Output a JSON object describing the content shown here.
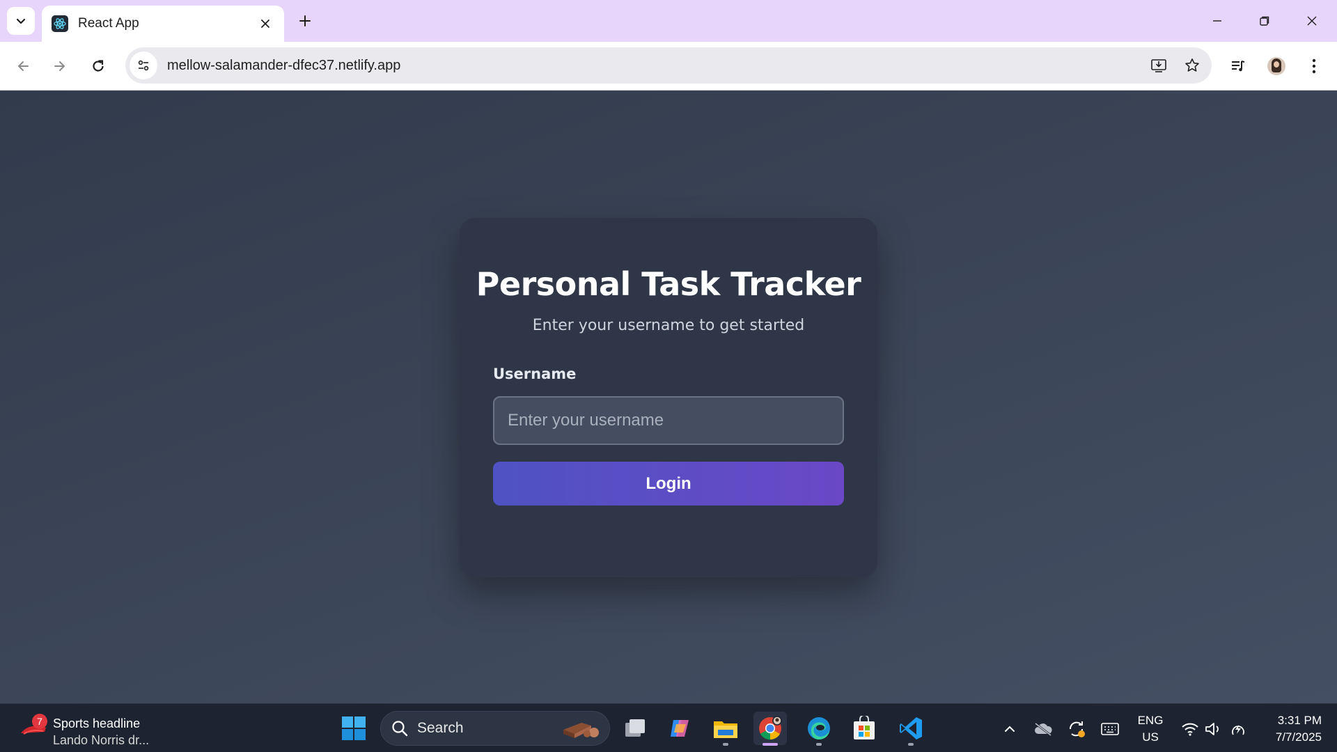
{
  "browser": {
    "tab": {
      "title": "React App"
    },
    "address_bar": {
      "url": "mellow-salamander-dfec37.netlify.app"
    }
  },
  "app": {
    "title": "Personal Task Tracker",
    "subtitle": "Enter your username to get started",
    "username_label": "Username",
    "username_placeholder": "Enter your username",
    "username_value": "",
    "login_label": "Login",
    "colors": {
      "card": "#2e3647",
      "button_start": "#4f52c4",
      "button_end": "#6a48c6"
    }
  },
  "taskbar": {
    "news": {
      "badge": "7",
      "title": "Sports headline",
      "subtitle": "Lando Norris dr..."
    },
    "search_label": "Search",
    "language": {
      "line1": "ENG",
      "line2": "US"
    },
    "clock": {
      "time": "3:31 PM",
      "date": "7/7/2025"
    }
  }
}
